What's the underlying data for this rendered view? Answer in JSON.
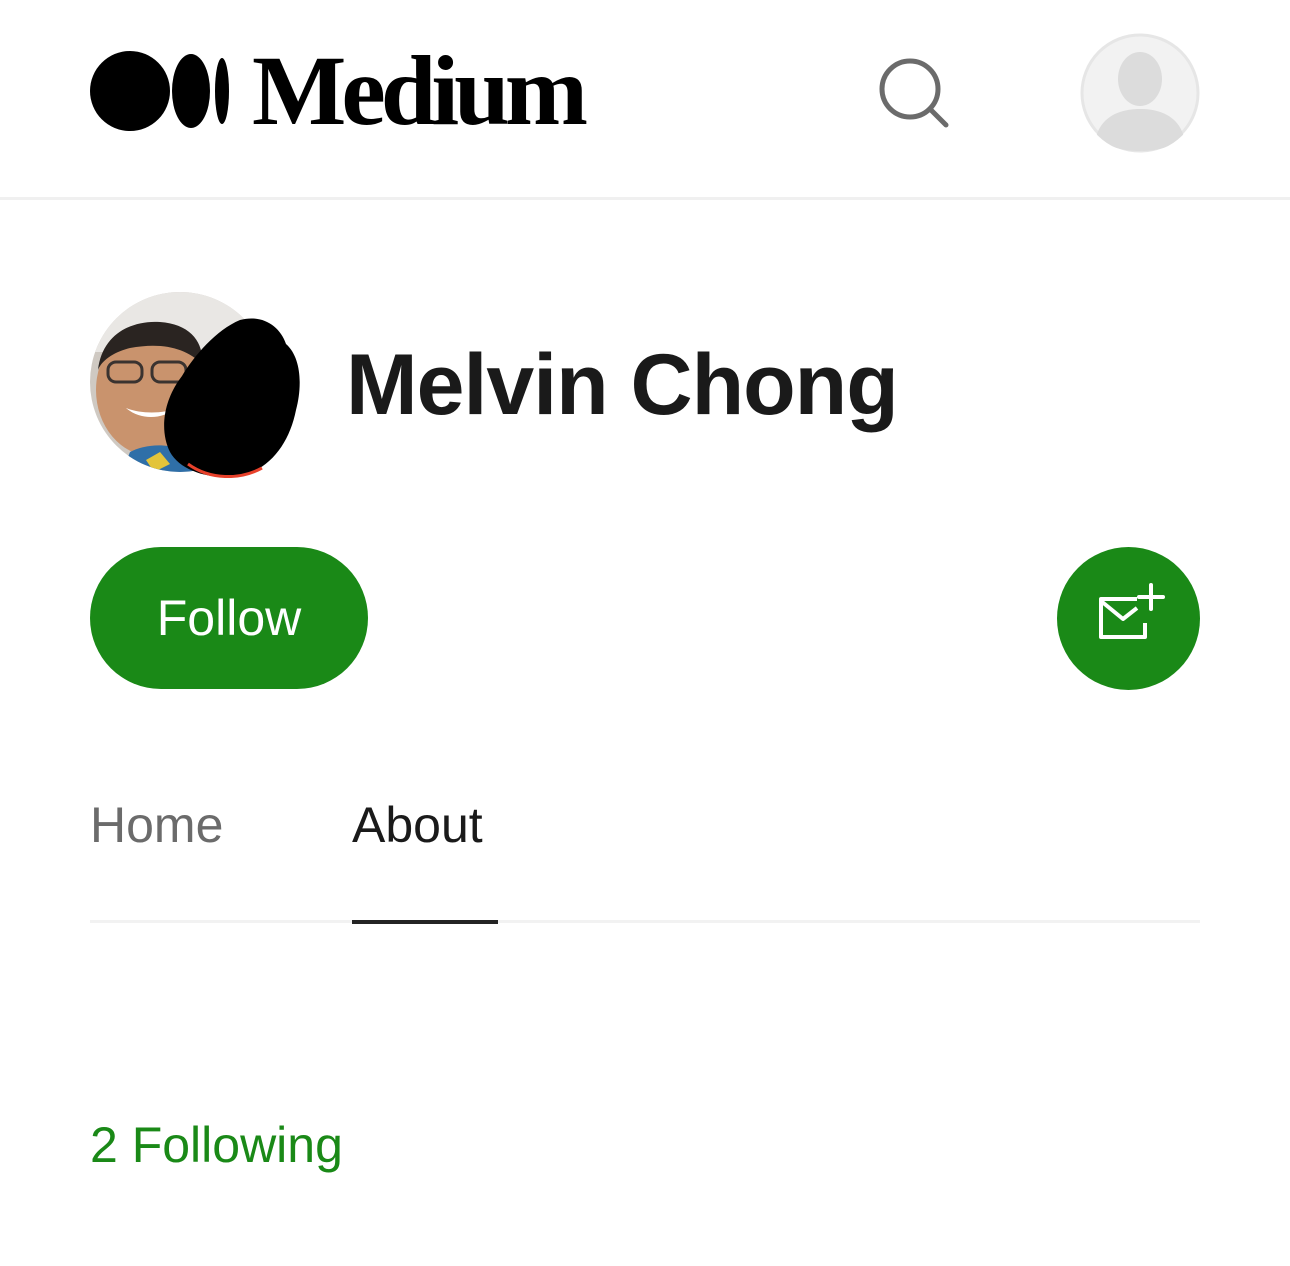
{
  "header": {
    "brand_name": "Medium",
    "search_icon": "search-icon",
    "avatar_icon": "default-user-avatar"
  },
  "profile": {
    "name": "Melvin Chong",
    "photo": "profile-photo"
  },
  "actions": {
    "follow_label": "Follow",
    "subscribe_icon": "mail-plus-icon"
  },
  "tabs": [
    {
      "label": "Home",
      "active": false
    },
    {
      "label": "About",
      "active": true
    }
  ],
  "stats": {
    "following_label": "2 Following"
  },
  "colors": {
    "accent": "#1a8917",
    "text_primary": "#1a1a1a",
    "text_secondary": "#6b6b6b",
    "divider": "#f2f2f2"
  }
}
